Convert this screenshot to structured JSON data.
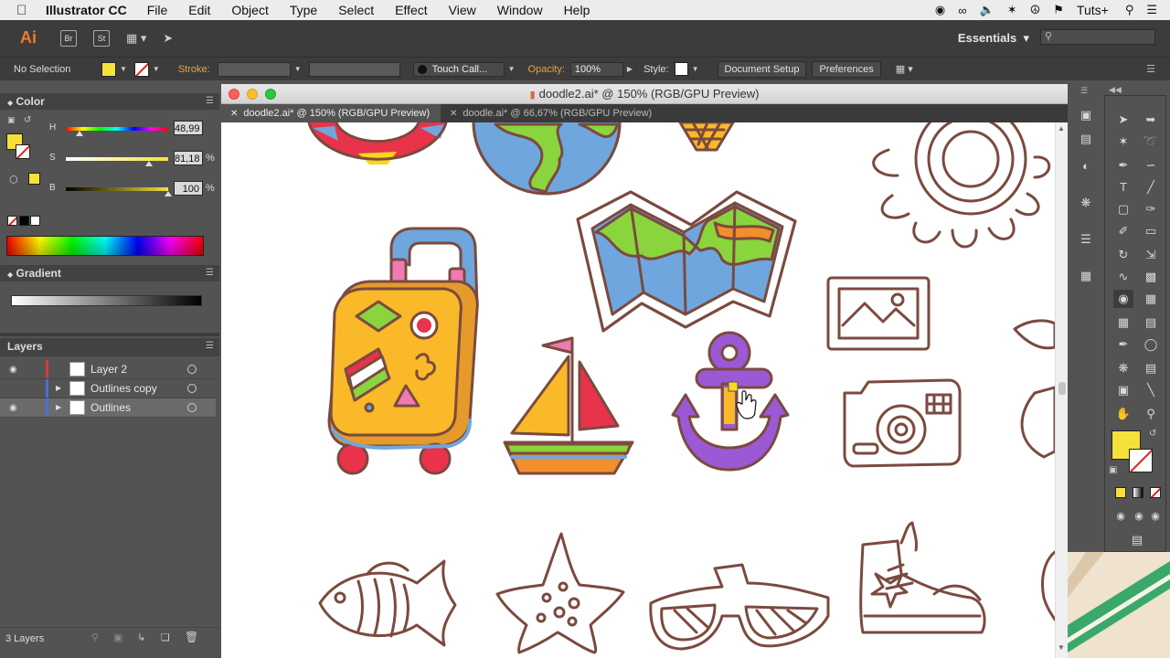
{
  "menubar": {
    "app_name": "Illustrator CC",
    "menus": [
      "File",
      "Edit",
      "Object",
      "Type",
      "Select",
      "Effect",
      "View",
      "Window",
      "Help"
    ],
    "right_label": "Tuts+"
  },
  "appbar": {
    "logo": "Ai",
    "br": "Br",
    "st": "St",
    "workspace": "Essentials"
  },
  "control": {
    "selection": "No Selection",
    "stroke_label": "Stroke:",
    "brush": "Touch Call...",
    "opacity_label": "Opacity:",
    "opacity_value": "100%",
    "style_label": "Style:",
    "document_setup": "Document Setup",
    "preferences": "Preferences",
    "fill_color": "#f6e13a"
  },
  "color_panel": {
    "title": "Color",
    "h_label": "H",
    "h_value": "48,99",
    "s_label": "S",
    "s_value": "81,18",
    "b_label": "B",
    "b_value": "100",
    "pct": "%",
    "h_fraction": 0.136,
    "s_fraction": 0.81,
    "b_fraction": 1.0
  },
  "gradient_panel": {
    "title": "Gradient"
  },
  "layers_panel": {
    "title": "Layers",
    "count": "3 Layers",
    "layers": [
      {
        "name": "Layer 2",
        "color": "#d33b3b",
        "selected": false
      },
      {
        "name": "Outlines copy",
        "color": "#4a6fd6",
        "selected": false
      },
      {
        "name": "Outlines",
        "color": "#4a6fd6",
        "selected": true
      }
    ]
  },
  "document": {
    "title": "doodle2.ai* @ 150% (RGB/GPU Preview)",
    "tabs": [
      {
        "label": "doodle2.ai* @ 150% (RGB/GPU Preview)",
        "active": true
      },
      {
        "label": "doodle.ai* @ 66,67% (RGB/GPU Preview)",
        "active": false
      }
    ]
  },
  "colors": {
    "outline": "#7b4a3f",
    "yellow": "#f9b928",
    "blue": "#6fa6dd",
    "green": "#8ad43d",
    "purple": "#9b59d6",
    "red": "#e8334a",
    "pink": "#f07bb2",
    "orange": "#f28e2b"
  }
}
